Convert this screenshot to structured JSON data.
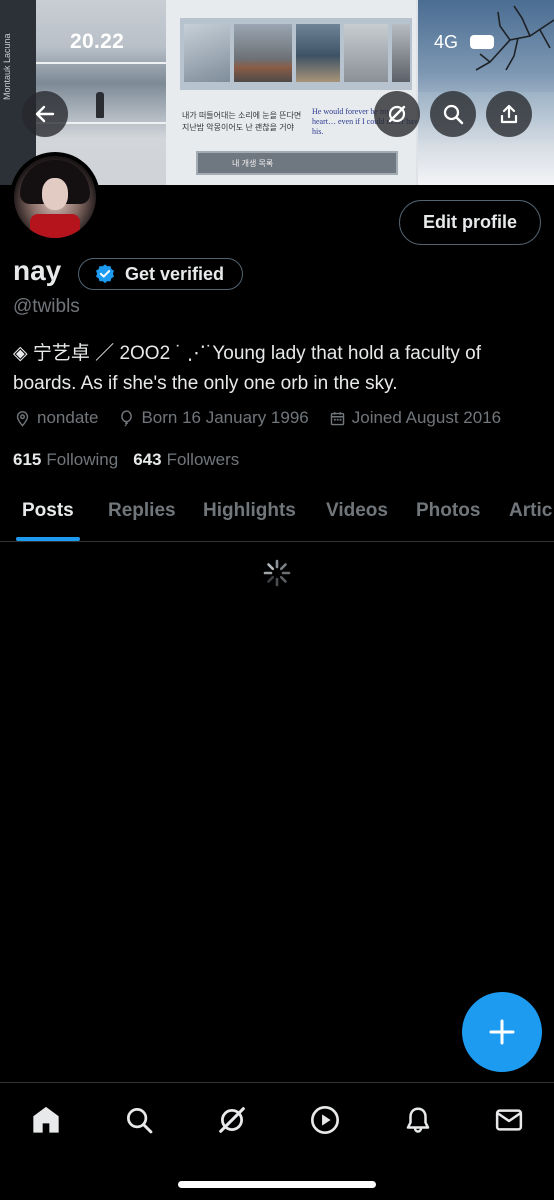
{
  "status_bar": {
    "time": "20.22",
    "network": "4G"
  },
  "banner": {
    "side_text": "Montauk Lacuna",
    "korean_text": "내가 떠들어대는 소리에 눈을 뜬다면\n지난밤 악몽이어도 난 괜찮을 거야",
    "english_text": "He would forever be my\nheart… even if I could never have\nhis.",
    "bar_label": "내 개생 목록"
  },
  "profile": {
    "display_name": "nay",
    "verify_label": "Get verified",
    "handle": "@twibls",
    "bio": "◈ 宁艺卓 ／ 2OO2 ˙ ⋰˙Young lady that hold a faculty of boards. As if she's the only one orb in the sky.",
    "location": "nondate",
    "born": "Born 16 January 1996",
    "joined": "Joined August 2016",
    "following_count": "615",
    "following_label": "Following",
    "followers_count": "643",
    "followers_label": "Followers",
    "edit_label": "Edit profile"
  },
  "tabs": [
    "Posts",
    "Replies",
    "Highlights",
    "Videos",
    "Photos",
    "Artic"
  ],
  "active_tab": "Posts",
  "colors": {
    "accent": "#1d9bf0",
    "muted": "#71767b",
    "text": "#e7e9ea",
    "background": "#000000"
  },
  "icons": {
    "overlay": [
      "back-arrow-icon",
      "grok-icon",
      "search-icon",
      "share-icon"
    ],
    "nav": [
      "home-icon",
      "search-icon",
      "grok-icon",
      "video-icon",
      "bell-icon",
      "mail-icon"
    ],
    "fab": "plus-icon"
  }
}
